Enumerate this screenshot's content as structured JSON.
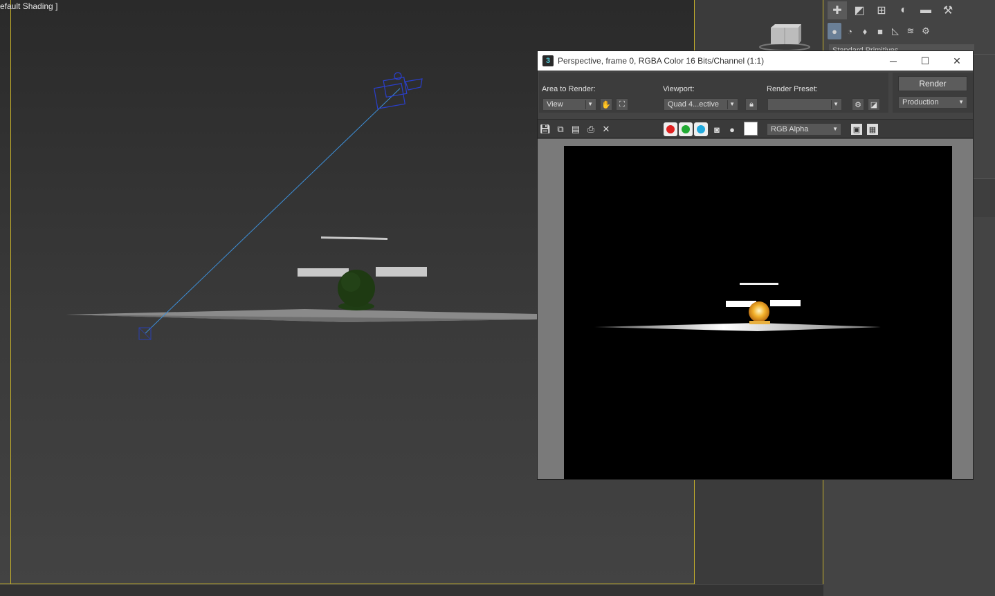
{
  "viewport": {
    "label": "efault Shading ]"
  },
  "command_panel": {
    "top_tabs": [
      "create-icon",
      "modify-icon",
      "hierarchy-icon",
      "motion-icon",
      "display-icon",
      "utilities-icon"
    ],
    "category_buttons": [
      "geometry-icon",
      "shapes-icon",
      "lights-icon",
      "cameras-icon",
      "helpers-icon",
      "spacewarps-icon",
      "systems-icon"
    ],
    "dropdown_text": "Standard Primitives"
  },
  "render_window": {
    "title": "Perspective, frame 0, RGBA Color 16 Bits/Channel (1:1)",
    "icon_text": "3",
    "area_to_render_label": "Area to Render:",
    "area_to_render_value": "View",
    "viewport_label": "Viewport:",
    "viewport_value": "Quad 4...ective",
    "render_preset_label": "Render Preset:",
    "render_preset_value": "",
    "render_button": "Render",
    "production_value": "Production",
    "channel_value": "RGB Alpha",
    "colors": {
      "red_channel": "#e02020",
      "green_channel": "#22aa33",
      "blue_channel": "#22aadd"
    }
  }
}
